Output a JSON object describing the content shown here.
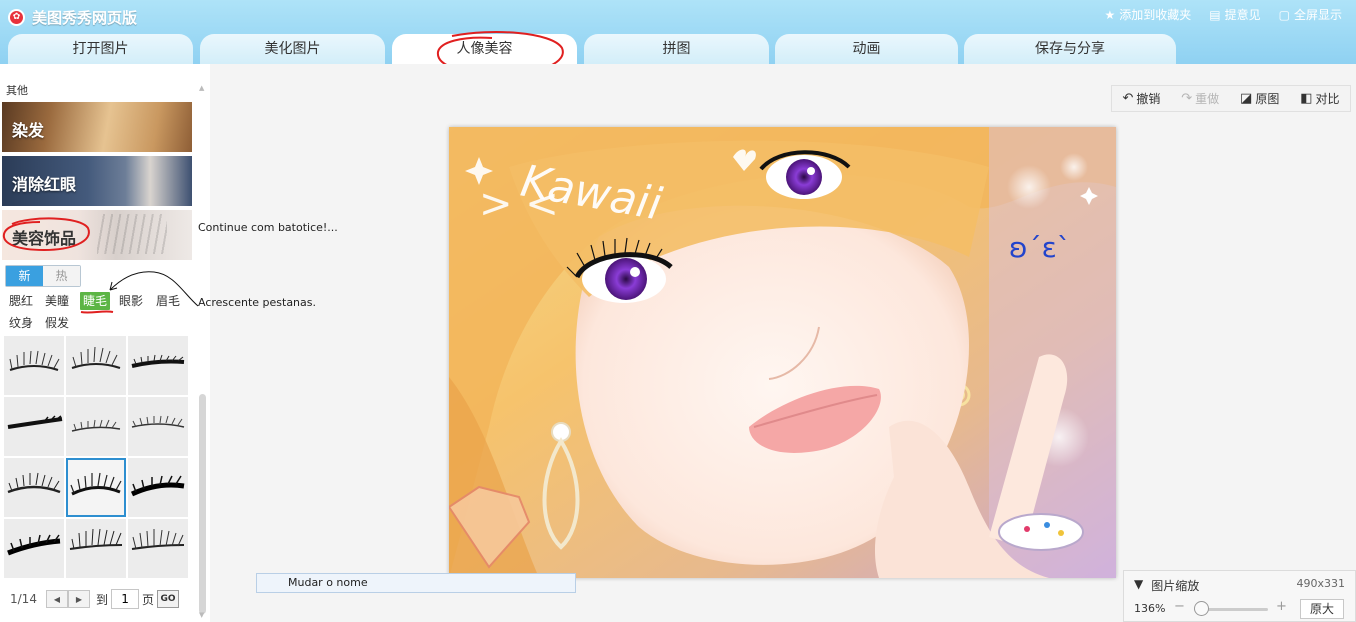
{
  "header": {
    "app_title": "美图秀秀网页版",
    "links": [
      "添加到收藏夹",
      "提意见",
      "全屏显示"
    ]
  },
  "tabs": [
    "打开图片",
    "美化图片",
    "人像美容",
    "拼图",
    "动画",
    "保存与分享"
  ],
  "active_tab": "人像美容",
  "left_panel": {
    "category_label": "其他",
    "banners": [
      "染发",
      "消除红眼",
      "美容饰品"
    ],
    "toggle": [
      "新",
      "热"
    ],
    "subcategories": [
      "腮红",
      "美瞳",
      "睫毛",
      "眼影",
      "眉毛",
      "纹身",
      "假发"
    ],
    "selected_subcategory": "睫毛",
    "pager": {
      "count": "1/14",
      "to_label": "到",
      "page_value": "1",
      "unit_label": "页",
      "go_label": "GO"
    }
  },
  "annotations": {
    "note_1": "Continue com batotice!...",
    "note_2": "Acrescente pestanas."
  },
  "toolbar": {
    "undo": "撤销",
    "redo": "重做",
    "original": "原图",
    "compare": "对比"
  },
  "photo_text": {
    "kawaii": "Kawaii",
    "face": "ʚ´ε`"
  },
  "rename_bar": "Mudar o nome",
  "zoom_panel": {
    "title": "图片缩放",
    "dims": "490x331",
    "percent": "136%",
    "original_size": "原大"
  },
  "colors": {
    "header": "#8fd1f2",
    "accent": "#3aa0e0",
    "selected": "#5cb545"
  }
}
